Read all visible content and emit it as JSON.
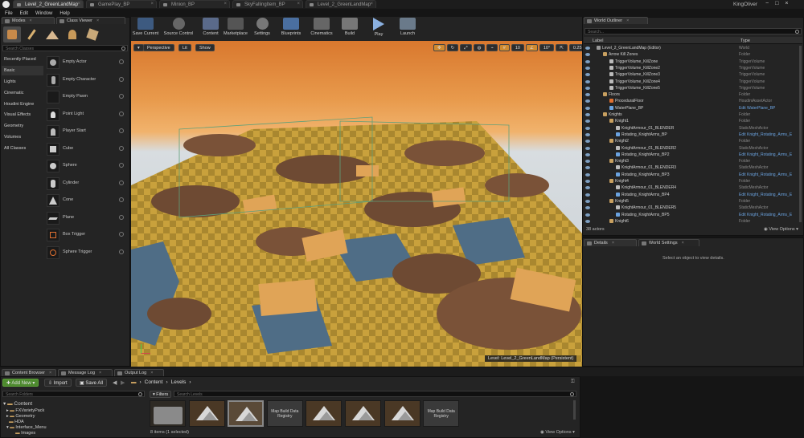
{
  "app": {
    "user": "KingOliver"
  },
  "doc_tabs": [
    "Level_2_GreenLandMap",
    "GamePlay_BP",
    "Minion_BP",
    "SkyFallingItem_BP",
    "Level_2_GreenLandMap"
  ],
  "menu": [
    "File",
    "Edit",
    "Window",
    "Help"
  ],
  "left_tabs": {
    "modes": "Modes",
    "class_viewer": "Class Viewer"
  },
  "search_classes": "Search Classes",
  "categories": [
    "Recently Placed",
    "Basic",
    "Lights",
    "Cinematic",
    "Houdini Engine",
    "Visual Effects",
    "Geometry",
    "Volumes",
    "All Classes"
  ],
  "place_items": [
    "Empty Actor",
    "Empty Character",
    "Empty Pawn",
    "Point Light",
    "Player Start",
    "Cube",
    "Sphere",
    "Cylinder",
    "Cone",
    "Plane",
    "Box Trigger",
    "Sphere Trigger"
  ],
  "toolbar": [
    "Save Current",
    "Source Control",
    "Content",
    "Marketplace",
    "Settings",
    "Blueprints",
    "Cinematics",
    "Build",
    "Play",
    "Launch"
  ],
  "viewport": {
    "perspective": "Perspective",
    "lit": "Lit",
    "show": "Show",
    "grid": "10",
    "angle": "10°",
    "scale": "0.25",
    "speed": "4",
    "level_label": "Level:  Level_2_GreenLandMap (Persistent)"
  },
  "outliner": {
    "title": "World Outliner",
    "search": "Search...",
    "col_label": "Label",
    "col_type": "Type",
    "rows": [
      {
        "label": "Level_2_GreenLandMap (Editor)",
        "type": "World",
        "indent": 0,
        "link": false
      },
      {
        "label": "Arrow Kill Zones",
        "type": "Folder",
        "indent": 1,
        "link": false
      },
      {
        "label": "TriggerVolume_KillZone",
        "type": "TriggerVolume",
        "indent": 2,
        "link": false
      },
      {
        "label": "TriggerVolume_KillZone2",
        "type": "TriggerVolume",
        "indent": 2,
        "link": false
      },
      {
        "label": "TriggerVolume_KillZone3",
        "type": "TriggerVolume",
        "indent": 2,
        "link": false
      },
      {
        "label": "TriggerVolume_KillZone4",
        "type": "TriggerVolume",
        "indent": 2,
        "link": false
      },
      {
        "label": "TriggerVolume_KillZone5",
        "type": "TriggerVolume",
        "indent": 2,
        "link": false
      },
      {
        "label": "Floors",
        "type": "Folder",
        "indent": 1,
        "link": false
      },
      {
        "label": "ProceduralFloor",
        "type": "HoudiniAssetActor",
        "indent": 2,
        "link": false
      },
      {
        "label": "WaterPlane_BP",
        "type": "Edit WaterPlane_BP",
        "indent": 2,
        "link": true
      },
      {
        "label": "Knights",
        "type": "Folder",
        "indent": 1,
        "link": false
      },
      {
        "label": "Knight1",
        "type": "Folder",
        "indent": 2,
        "link": false
      },
      {
        "label": "KnightArmour_01_BLENDER",
        "type": "StaticMeshActor",
        "indent": 3,
        "link": false
      },
      {
        "label": "Rotating_KnightArms_BP",
        "type": "Edit Knight_Rotating_Arms_E",
        "indent": 3,
        "link": true
      },
      {
        "label": "Knight2",
        "type": "Folder",
        "indent": 2,
        "link": false
      },
      {
        "label": "KnightArmour_01_BLENDER2",
        "type": "StaticMeshActor",
        "indent": 3,
        "link": false
      },
      {
        "label": "Rotating_KnightArms_BP2",
        "type": "Edit Knight_Rotating_Arms_E",
        "indent": 3,
        "link": true
      },
      {
        "label": "Knight3",
        "type": "Folder",
        "indent": 2,
        "link": false
      },
      {
        "label": "KnightArmour_01_BLENDER3",
        "type": "StaticMeshActor",
        "indent": 3,
        "link": false
      },
      {
        "label": "Rotating_KnightArms_BP3",
        "type": "Edit Knight_Rotating_Arms_E",
        "indent": 3,
        "link": true
      },
      {
        "label": "Knight4",
        "type": "Folder",
        "indent": 2,
        "link": false
      },
      {
        "label": "KnightArmour_01_BLENDER4",
        "type": "StaticMeshActor",
        "indent": 3,
        "link": false
      },
      {
        "label": "Rotating_KnightArms_BP4",
        "type": "Edit Knight_Rotating_Arms_E",
        "indent": 3,
        "link": true
      },
      {
        "label": "Knight5",
        "type": "Folder",
        "indent": 2,
        "link": false
      },
      {
        "label": "KnightArmour_01_BLENDER5",
        "type": "StaticMeshActor",
        "indent": 3,
        "link": false
      },
      {
        "label": "Rotating_KnightArms_BP5",
        "type": "Edit Knight_Rotating_Arms_E",
        "indent": 3,
        "link": true
      },
      {
        "label": "Knight6",
        "type": "Folder",
        "indent": 2,
        "link": false
      }
    ],
    "actor_count": "38 actors",
    "view_options": "View Options"
  },
  "details": {
    "tab": "Details",
    "tab2": "World Settings",
    "empty": "Select an object to view details."
  },
  "bottom_tabs": [
    "Content Browser",
    "Message Log",
    "Output Log"
  ],
  "content_browser": {
    "add_new": "Add New",
    "import": "Import",
    "save_all": "Save All",
    "path": [
      "Content",
      "Levels"
    ],
    "search_folders": "Search Folders",
    "filters": "Filters",
    "search_levels": "Search Levels",
    "tree": [
      "Content",
      "FXVarietyPack",
      "Geometry",
      "HDA",
      "Interface_Menu",
      "Images"
    ],
    "assets": [
      {
        "kind": "folder",
        "label": ""
      },
      {
        "kind": "level",
        "label": ""
      },
      {
        "kind": "level-sel",
        "label": ""
      },
      {
        "kind": "registry",
        "label": "Map Build Data Registry"
      },
      {
        "kind": "level",
        "label": ""
      },
      {
        "kind": "level",
        "label": ""
      },
      {
        "kind": "level",
        "label": ""
      },
      {
        "kind": "registry",
        "label": "Map Build Data Registry"
      }
    ],
    "status": "8 items (1 selected)",
    "view_options": "View Options"
  }
}
